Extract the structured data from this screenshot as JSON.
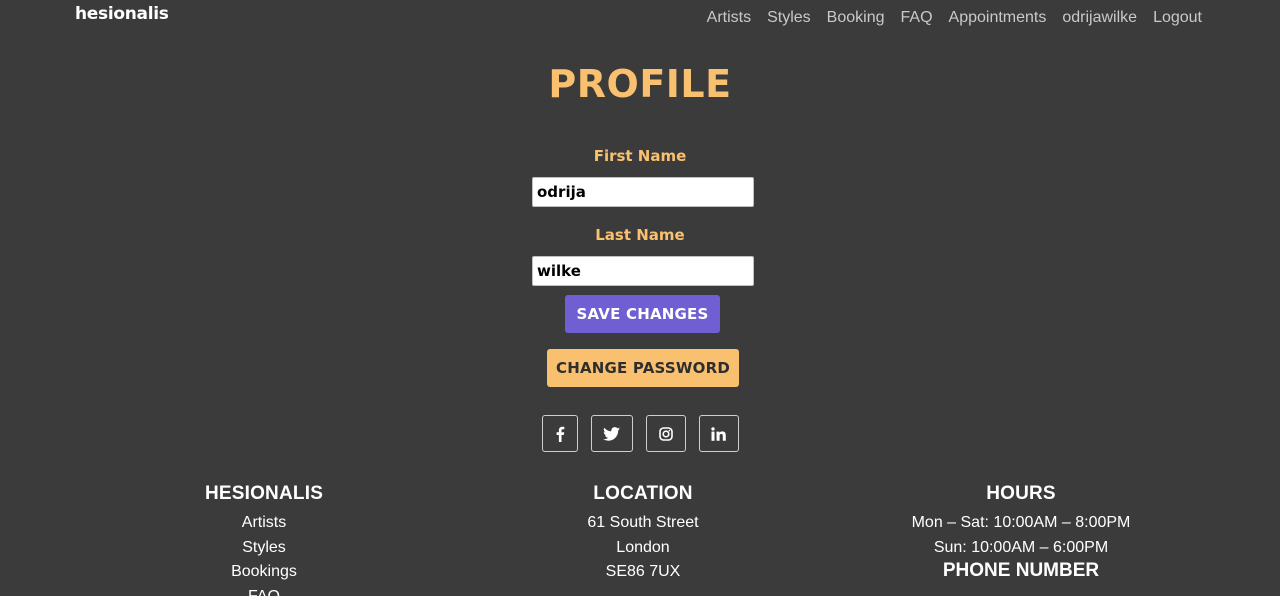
{
  "brand": "hesionalis",
  "nav": {
    "items": [
      "Artists",
      "Styles",
      "Booking",
      "FAQ",
      "Appointments",
      "odrijawilke",
      "Logout"
    ]
  },
  "page_title": "PROFILE",
  "form": {
    "first_name_label": "First Name",
    "first_name_value": "odrija",
    "last_name_label": "Last Name",
    "last_name_value": "wilke",
    "save_label": "SAVE CHANGES",
    "change_password_label": "CHANGE PASSWORD"
  },
  "social": {
    "icons": [
      "facebook-icon",
      "twitter-icon",
      "instagram-icon",
      "linkedin-icon"
    ]
  },
  "footer": {
    "col1": {
      "heading": "HESIONALIS",
      "links": [
        "Artists",
        "Styles",
        "Bookings",
        "FAQ"
      ]
    },
    "col2": {
      "heading": "LOCATION",
      "lines": [
        "61 South Street",
        "London",
        "SE86 7UX"
      ]
    },
    "col3": {
      "heading": "HOURS",
      "lines": [
        "Mon – Sat: 10:00AM – 8:00PM",
        "Sun: 10:00AM – 6:00PM"
      ],
      "phone_heading": "PHONE NUMBER"
    }
  },
  "colors": {
    "background": "#3c3b3b",
    "accent": "#f9c06f",
    "primary_button": "#6f5fd3"
  }
}
